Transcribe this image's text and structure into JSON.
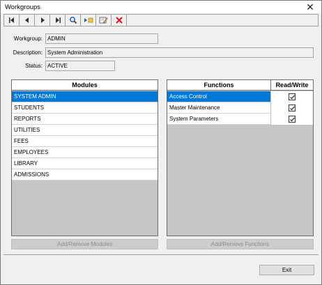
{
  "window": {
    "title": "Workgroups"
  },
  "toolbar": {
    "buttons": [
      {
        "icon": "first-record-icon"
      },
      {
        "icon": "previous-record-icon"
      },
      {
        "icon": "next-record-icon"
      },
      {
        "icon": "last-record-icon"
      },
      {
        "icon": "find-icon"
      },
      {
        "icon": "new-record-icon"
      },
      {
        "icon": "edit-icon"
      },
      {
        "icon": "delete-icon"
      }
    ]
  },
  "form": {
    "workgroup_label": "Workgroup:",
    "workgroup_value": "ADMIN",
    "description_label": "Description:",
    "description_value": "System Administration",
    "status_label": "Status:",
    "status_value": "ACTIVE"
  },
  "modules": {
    "header": "Modules",
    "items": [
      "SYSTEM ADMIN",
      "STUDENTS",
      "REPORTS",
      "UTILITIES",
      "FEES",
      "EMPLOYEES",
      "LIBRARY",
      "ADMISSIONS"
    ],
    "selected_index": 0,
    "add_remove_label": "Add/Remove Modules"
  },
  "functions": {
    "header_name": "Functions",
    "header_rw": "Read/Write",
    "items": [
      {
        "name": "Access Control",
        "read_write": true
      },
      {
        "name": "Master Maintenance",
        "read_write": true
      },
      {
        "name": "System Parameters",
        "read_write": true
      }
    ],
    "selected_index": 0,
    "add_remove_label": "Add/Remove Functions"
  },
  "footer": {
    "exit_label": "Exit"
  },
  "colors": {
    "selection": "#0078d7",
    "delete_red": "#e81123"
  }
}
